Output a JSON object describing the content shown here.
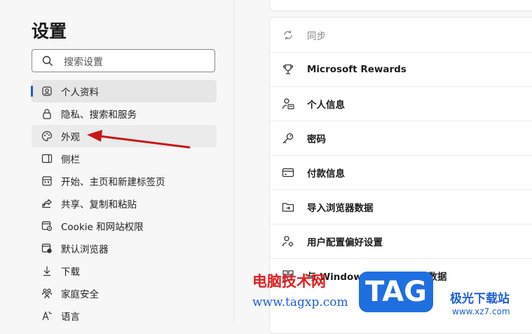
{
  "sidebar": {
    "title": "设置",
    "search_placeholder": "搜索设置",
    "items": [
      {
        "label": "个人资料",
        "icon": "profile-icon"
      },
      {
        "label": "隐私、搜索和服务",
        "icon": "lock-icon"
      },
      {
        "label": "外观",
        "icon": "palette-icon"
      },
      {
        "label": "侧栏",
        "icon": "sidebar-icon"
      },
      {
        "label": "开始、主页和新建标签页",
        "icon": "home-grid-icon"
      },
      {
        "label": "共享、复制和粘贴",
        "icon": "share-icon"
      },
      {
        "label": "Cookie 和网站权限",
        "icon": "site-permissions-icon"
      },
      {
        "label": "默认浏览器",
        "icon": "browser-icon"
      },
      {
        "label": "下载",
        "icon": "download-icon"
      },
      {
        "label": "家庭安全",
        "icon": "family-icon"
      },
      {
        "label": "语言",
        "icon": "language-icon"
      }
    ]
  },
  "main": {
    "rows": [
      {
        "label": "同步",
        "icon": "sync-icon"
      },
      {
        "label": "Microsoft Rewards",
        "icon": "trophy-icon"
      },
      {
        "label": "个人信息",
        "icon": "person-card-icon"
      },
      {
        "label": "密码",
        "icon": "key-icon"
      },
      {
        "label": "付款信息",
        "icon": "credit-card-icon"
      },
      {
        "label": "导入浏览器数据",
        "icon": "import-folder-icon"
      },
      {
        "label": "用户配置偏好设置",
        "icon": "person-gear-icon"
      },
      {
        "label": "与 Windows 功能共享浏览数据",
        "icon": "windows-share-icon"
      }
    ]
  },
  "watermark": {
    "site_name": "电脑技术网",
    "site_url": "www.tagxp.com",
    "tag_text": "TAG",
    "site2_name": "极光下载站",
    "site2_url": "www.xz7.com"
  },
  "colors": {
    "accent": "#1a5fb4",
    "arrow": "#c8171b",
    "tag": "#1f6fe0"
  }
}
